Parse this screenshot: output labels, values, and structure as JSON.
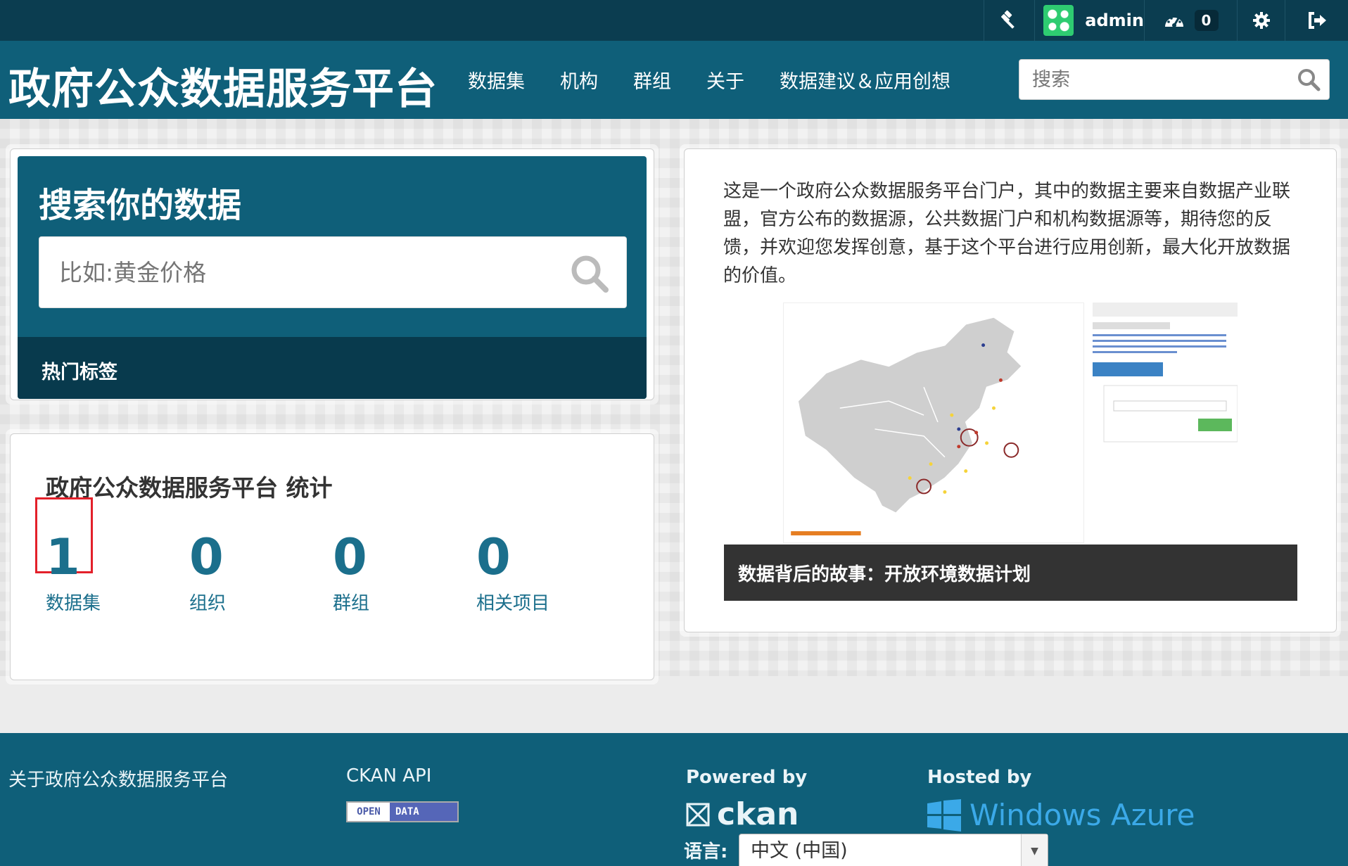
{
  "account": {
    "username": "admin",
    "dashboard_count": "0",
    "icons": [
      "sysadmin-gavel-icon",
      "dashboard-icon",
      "gear-icon",
      "logout-icon"
    ]
  },
  "header": {
    "site_title": "政府公众数据服务平台",
    "nav": [
      "数据集",
      "机构",
      "群组",
      "关于",
      "数据建议＆应用创想"
    ],
    "search_placeholder": "搜索"
  },
  "search_module": {
    "title": "搜索你的数据",
    "placeholder": "比如:黄金价格",
    "tags_heading": "热门标签"
  },
  "stats": {
    "title": "政府公众数据服务平台 统计",
    "items": [
      {
        "value": "1",
        "label": "数据集"
      },
      {
        "value": "0",
        "label": "组织"
      },
      {
        "value": "0",
        "label": "群组"
      },
      {
        "value": "0",
        "label": "相关项目"
      }
    ]
  },
  "story": {
    "text": "这是一个政府公众数据服务平台门户，其中的数据主要来自数据产业联盟，官方公布的数据源，公共数据门户和机构数据源等，期待您的反馈，并欢迎您发挥创意，基于这个平台进行应用创新，最大化开放数据的价值。",
    "caption": "数据背后的故事：开放环境数据计划"
  },
  "footer": {
    "about": "关于政府公众数据服务平台",
    "api": "CKAN API",
    "open_data_badge": {
      "left": "OPEN",
      "right": "DATA"
    },
    "powered_by": "Powered by",
    "ckan": "ckan",
    "hosted_by": "Hosted by",
    "azure": "Windows Azure",
    "language_label": "语言:",
    "language_value": "中文 (中国)"
  },
  "colors": {
    "masthead": "#0b3d50",
    "header": "#0f5f79",
    "link": "#1b6f8c",
    "highlight": "#e3202a"
  }
}
